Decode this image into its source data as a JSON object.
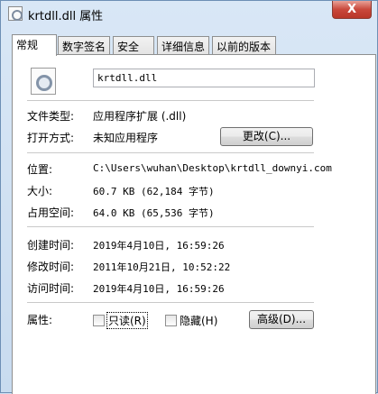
{
  "window": {
    "title": "krtdll.dll 属性",
    "close_label": "X"
  },
  "tabs": [
    {
      "label": "常规"
    },
    {
      "label": "数字签名"
    },
    {
      "label": "安全"
    },
    {
      "label": "详细信息"
    },
    {
      "label": "以前的版本"
    }
  ],
  "general": {
    "file_name": "krtdll.dll",
    "type": {
      "label": "文件类型:",
      "value": "应用程序扩展 (.dll)"
    },
    "opens_with": {
      "label": "打开方式:",
      "value": "未知应用程序",
      "change_button": "更改(C)..."
    },
    "location": {
      "label": "位置:",
      "value": "C:\\Users\\wuhan\\Desktop\\krtdll_downyi.com"
    },
    "size": {
      "label": "大小:",
      "value": "60.7 KB (62,184 字节)"
    },
    "size_on_disk": {
      "label": "占用空间:",
      "value": "64.0 KB (65,536 字节)"
    },
    "created": {
      "label": "创建时间:",
      "value": "2019年4月10日, 16:59:26"
    },
    "modified": {
      "label": "修改时间:",
      "value": "2011年10月21日, 10:52:22"
    },
    "accessed": {
      "label": "访问时间:",
      "value": "2019年4月10日, 16:59:26"
    },
    "attributes": {
      "label": "属性:",
      "readonly": "只读(R)",
      "hidden": "隐藏(H)",
      "advanced_button": "高级(D)..."
    }
  }
}
